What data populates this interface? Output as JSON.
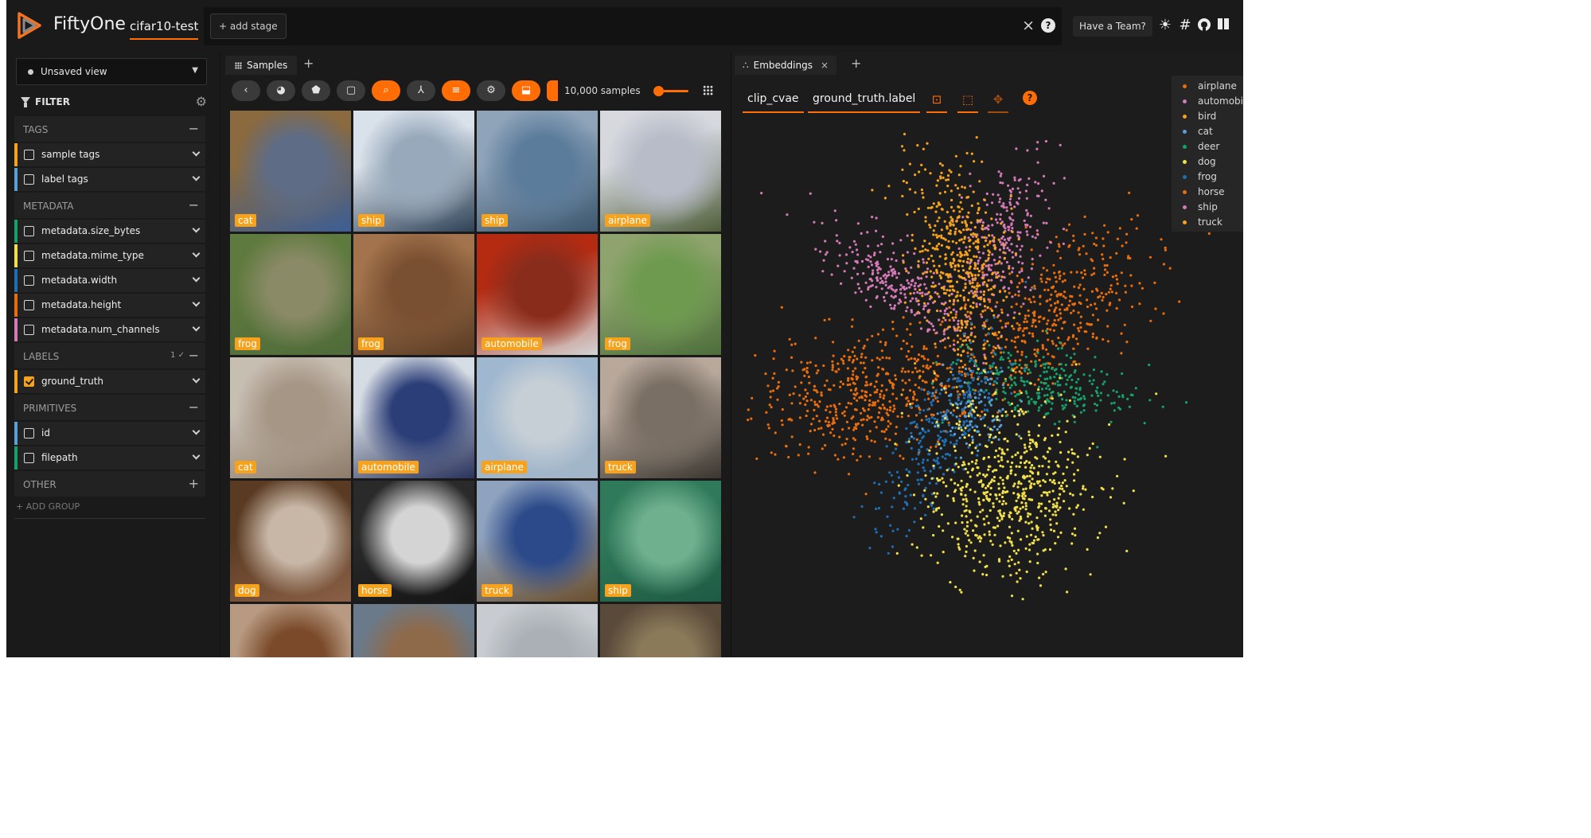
{
  "header": {
    "app_name": "FiftyOne",
    "dataset": "cifar10-test",
    "add_stage": "+ add stage",
    "close_icon": "×",
    "help_icon": "?",
    "team_button": "Have a Team?",
    "icons": [
      "sun-icon",
      "slack-icon",
      "github-icon",
      "docs-icon"
    ]
  },
  "sidebar": {
    "view": "Unsaved view",
    "filter_title": "FILTER",
    "groups": [
      {
        "label": "TAGS",
        "action": "−",
        "fields": [
          {
            "label": "sample tags",
            "color": "#f6a21d",
            "checked": false
          },
          {
            "label": "label tags",
            "color": "#5aa0d8",
            "checked": false
          }
        ]
      },
      {
        "label": "METADATA",
        "action": "−",
        "fields": [
          {
            "label": "metadata.size_bytes",
            "color": "#16a06a",
            "checked": false
          },
          {
            "label": "metadata.mime_type",
            "color": "#f1e04a",
            "checked": false
          },
          {
            "label": "metadata.width",
            "color": "#1f6fb4",
            "checked": false
          },
          {
            "label": "metadata.height",
            "color": "#ea6d0c",
            "checked": false
          },
          {
            "label": "metadata.num_channels",
            "color": "#d47ab7",
            "checked": false
          }
        ]
      },
      {
        "label": "LABELS",
        "action": "−",
        "badge": "1 ✓",
        "fields": [
          {
            "label": "ground_truth",
            "color": "#f6a21d",
            "checked": true
          }
        ]
      },
      {
        "label": "PRIMITIVES",
        "action": "−",
        "fields": [
          {
            "label": "id",
            "color": "#5aa0d8",
            "checked": false
          },
          {
            "label": "filepath",
            "color": "#16a06a",
            "checked": false
          }
        ]
      },
      {
        "label": "OTHER",
        "action": "+",
        "fields": []
      }
    ],
    "add_group": "+ ADD GROUP"
  },
  "samples_panel": {
    "tab": "Samples",
    "tab_add": "+",
    "count": "10,000 samples",
    "tiles": [
      {
        "label": "cat",
        "colors": [
          "#8a6a3e",
          "#5e6c86",
          "#3b5e97"
        ]
      },
      {
        "label": "ship",
        "colors": [
          "#d9e1ea",
          "#98a9bb",
          "#2e4257"
        ]
      },
      {
        "label": "ship",
        "colors": [
          "#8fa4b9",
          "#5c7c9c",
          "#3b566e"
        ]
      },
      {
        "label": "airplane",
        "colors": [
          "#d6d8de",
          "#b7bcc8",
          "#4f5e3a"
        ]
      },
      {
        "label": "frog",
        "colors": [
          "#5f7a3e",
          "#8a8a66",
          "#4f6b3a"
        ]
      },
      {
        "label": "frog",
        "colors": [
          "#a2734c",
          "#7a5032",
          "#5a3b24"
        ]
      },
      {
        "label": "automobile",
        "colors": [
          "#b52b12",
          "#8a2c1c",
          "#d4d4d4"
        ]
      },
      {
        "label": "frog",
        "colors": [
          "#8fa36e",
          "#6e9a4f",
          "#4c6e3a"
        ]
      },
      {
        "label": "cat",
        "colors": [
          "#c7beb2",
          "#a69686",
          "#8e7c6a"
        ]
      },
      {
        "label": "automobile",
        "colors": [
          "#d6dce4",
          "#2c3e78",
          "#29335c"
        ]
      },
      {
        "label": "airplane",
        "colors": [
          "#9fb7cf",
          "#c7cfd6",
          "#a3b6c8"
        ]
      },
      {
        "label": "truck",
        "colors": [
          "#b8a89c",
          "#7a6f64",
          "#3a3630"
        ]
      },
      {
        "label": "dog",
        "colors": [
          "#5a3a22",
          "#c8b7a6",
          "#8a6046"
        ]
      },
      {
        "label": "horse",
        "colors": [
          "#2a2a2a",
          "#d4d4d4",
          "#151515"
        ]
      },
      {
        "label": "truck",
        "colors": [
          "#8fa3bf",
          "#2c4a8a",
          "#6b4f2c"
        ]
      },
      {
        "label": "ship",
        "colors": [
          "#2f7a5a",
          "#6fb08e",
          "#1f5a44"
        ]
      },
      {
        "label": "",
        "colors": [
          "#b89a82",
          "#7a4a2a",
          "#d8c8b8"
        ]
      },
      {
        "label": "",
        "colors": [
          "#6a7a8a",
          "#8f6a4a",
          "#5a6a7a"
        ]
      },
      {
        "label": "",
        "colors": [
          "#c8ccd0",
          "#aab0b6",
          "#8e969e"
        ]
      },
      {
        "label": "",
        "colors": [
          "#5a4a3a",
          "#8a7a5a",
          "#3a2e22"
        ]
      }
    ]
  },
  "embeddings_panel": {
    "tab": "Embeddings",
    "tab_close": "×",
    "tab_add": "+",
    "brain_key": "clip_cvae",
    "color_by": "ground_truth.label",
    "help": "?",
    "legend": [
      {
        "label": "airplane",
        "color": "#ea6d0c"
      },
      {
        "label": "automobile",
        "color": "#d47ab7"
      },
      {
        "label": "bird",
        "color": "#f6a21d"
      },
      {
        "label": "cat",
        "color": "#5aa0d8"
      },
      {
        "label": "deer",
        "color": "#16a06a"
      },
      {
        "label": "dog",
        "color": "#f1e04a"
      },
      {
        "label": "frog",
        "color": "#1f6fb4"
      },
      {
        "label": "horse",
        "color": "#ea6d0c"
      },
      {
        "label": "ship",
        "color": "#d47ab7"
      },
      {
        "label": "truck",
        "color": "#f6a21d"
      }
    ]
  }
}
